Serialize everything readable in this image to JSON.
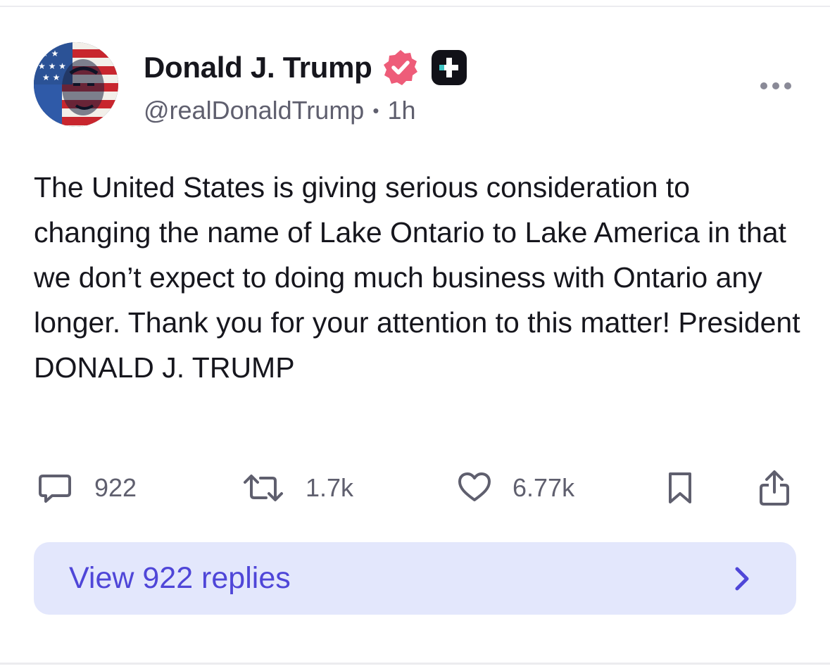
{
  "post": {
    "author": {
      "display_name": "Donald J. Trump",
      "handle": "@realDonaldTrump",
      "verified": true,
      "avatar_icon": "flag-portrait-avatar"
    },
    "time_ago": "1h",
    "text": "The United States is giving serious consideration to changing the name of Lake Ontario to Lake America in that we don’t expect to doing much business with Ontario any longer. Thank you for your attention to this matter! President DONALD J. TRUMP",
    "actions": {
      "replies_count": "922",
      "reposts_count": "1.7k",
      "likes_count": "6.77k",
      "bookmark_icon": "bookmark-icon",
      "share_icon": "share-icon"
    },
    "view_replies_label": "View 922 replies"
  },
  "colors": {
    "verified": "#ee5c79",
    "link": "#4f46d8",
    "replies_bg": "#e3e7fc",
    "muted_text": "#5f5f6e",
    "text": "#16161d"
  }
}
